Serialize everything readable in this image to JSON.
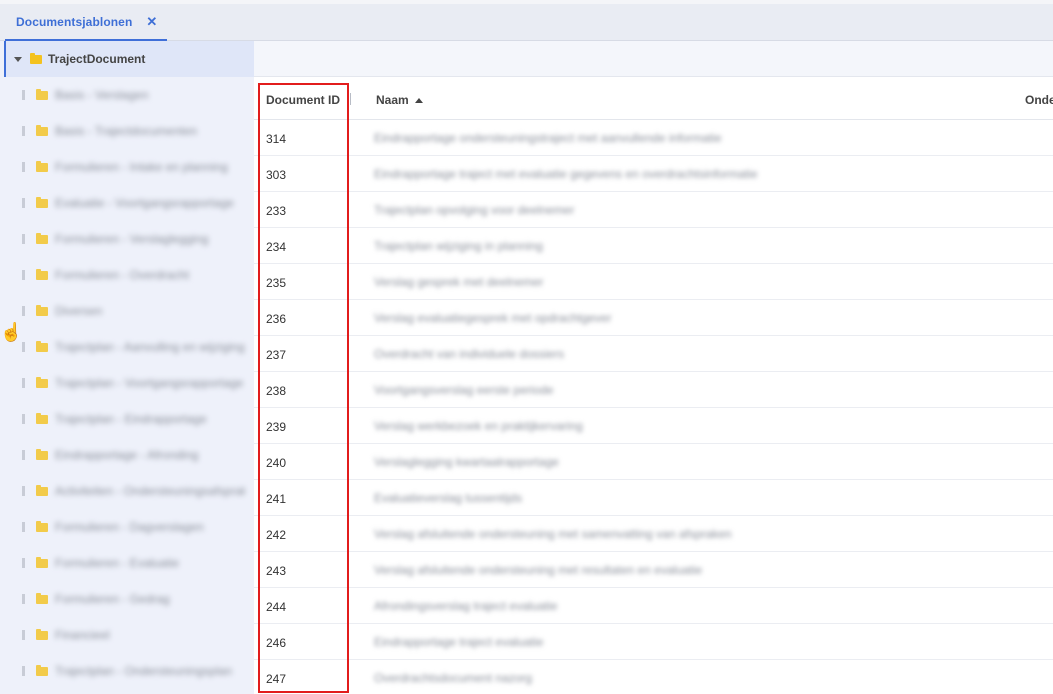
{
  "tab": {
    "label": "Documentsjablonen",
    "close": "✕"
  },
  "tree": {
    "root_label": "TrajectDocument",
    "items": [
      "Basis - Verslagen",
      "Basis - Trajectdocumenten",
      "Formulieren - Intake en planning",
      "Evaluatie - Voortgangsrapportage",
      "Formulieren - Verslaglegging",
      "Formulieren - Overdracht",
      "Diversen",
      "Trajectplan - Aanvulling en wijziging",
      "Trajectplan - Voortgangsrapportage",
      "Trajectplan - Eindrapportage",
      "Eindrapportage - Afronding",
      "Activiteiten - Ondersteuningsafspraken",
      "Formulieren - Dagverslagen",
      "Formulieren - Evaluatie",
      "Formulieren - Gedrag",
      "Financieel",
      "Trajectplan - Ondersteuningsplan"
    ]
  },
  "grid": {
    "columns": {
      "id": "Document ID",
      "name": "Naam",
      "extra": "Onde"
    },
    "rows": [
      {
        "id": "314",
        "name": "Eindrapportage ondersteuningstraject met aanvullende informatie"
      },
      {
        "id": "303",
        "name": "Eindrapportage traject met evaluatie gegevens en overdrachtsinformatie"
      },
      {
        "id": "233",
        "name": "Trajectplan opvolging voor deelnemer"
      },
      {
        "id": "234",
        "name": "Trajectplan wijziging in planning"
      },
      {
        "id": "235",
        "name": "Verslag gesprek met deelnemer"
      },
      {
        "id": "236",
        "name": "Verslag evaluatiegesprek met opdrachtgever"
      },
      {
        "id": "237",
        "name": "Overdracht van individuele dossiers"
      },
      {
        "id": "238",
        "name": "Voortgangsverslag eerste periode"
      },
      {
        "id": "239",
        "name": "Verslag werkbezoek en praktijkervaring"
      },
      {
        "id": "240",
        "name": "Verslaglegging kwartaalrapportage"
      },
      {
        "id": "241",
        "name": "Evaluatieverslag tussentijds"
      },
      {
        "id": "242",
        "name": "Verslag afsluitende ondersteuning met samenvatting van afspraken"
      },
      {
        "id": "243",
        "name": "Verslag afsluitende ondersteuning met resultaten en evaluatie"
      },
      {
        "id": "244",
        "name": "Afrondingsverslag traject evaluatie"
      },
      {
        "id": "246",
        "name": "Eindrapportage traject evaluatie"
      },
      {
        "id": "247",
        "name": "Overdrachtsdocument nazorg"
      }
    ]
  }
}
